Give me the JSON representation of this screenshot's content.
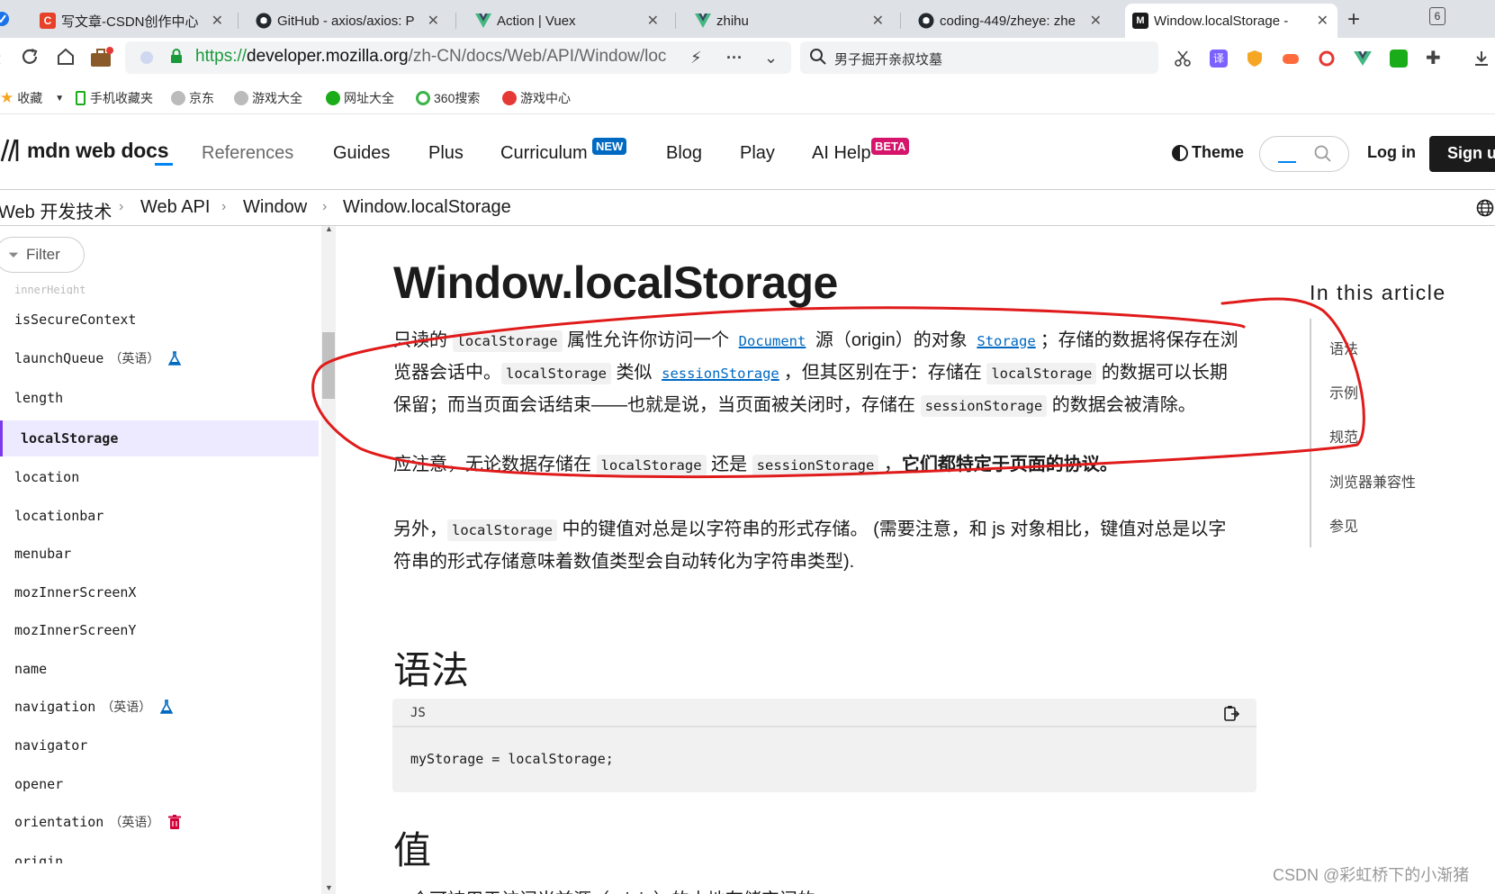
{
  "browser": {
    "tabs": [
      {
        "title": "写文章-CSDN创作中心",
        "icon": "csdn-icon",
        "color": "#e8412a"
      },
      {
        "title": "GitHub - axios/axios: P",
        "icon": "github-icon",
        "color": "#24292f"
      },
      {
        "title": "Action | Vuex",
        "icon": "vue-icon",
        "color": "#42b883"
      },
      {
        "title": "zhihu",
        "icon": "vue-icon",
        "color": "#42b883"
      },
      {
        "title": "coding-449/zheye: zhe",
        "icon": "github-icon",
        "color": "#24292f"
      },
      {
        "title": "Window.localStorage -",
        "icon": "mdn-icon",
        "color": "#1b1b1b"
      }
    ],
    "tab_count": "6",
    "url": {
      "protocol": "https://",
      "host": "developer.mozilla.org",
      "path": "/zh-CN/docs/Web/API/Window/loc"
    },
    "search_query": "男子掘开亲叔坟墓",
    "bookmarks": [
      "收藏",
      "手机收藏夹",
      "京东",
      "游戏大全",
      "网址大全",
      "360搜索",
      "游戏中心"
    ]
  },
  "mdn": {
    "logo": "mdn web docs",
    "menu": [
      "References",
      "Guides",
      "Plus",
      "Curriculum",
      "Blog",
      "Play",
      "AI Help"
    ],
    "badge_new": "NEW",
    "badge_beta": "BETA",
    "theme": "Theme",
    "login": "Log in",
    "signup": "Sign up",
    "accent": "#0085f2"
  },
  "breadcrumb": [
    "Web 开发技术",
    "Web API",
    "Window",
    "Window.localStorage"
  ],
  "sidebar": {
    "filter": "Filter",
    "tag_en": "（英语）",
    "items": [
      "isSecureContext",
      "launchQueue",
      "length",
      "localStorage",
      "location",
      "locationbar",
      "menubar",
      "mozInnerScreenX",
      "mozInnerScreenY",
      "name",
      "navigation",
      "navigator",
      "opener",
      "orientation",
      "origin"
    ]
  },
  "article": {
    "title": "Window.localStorage",
    "p1": {
      "t1": "只读的 ",
      "c1": "localStorage",
      "t2": " 属性允许你访问一个 ",
      "l1": "Document",
      "t3": " 源（origin）的对象 ",
      "l2": "Storage",
      "t4": "；存储的数据将保存在浏览器会话中。",
      "c2": "localStorage",
      "t5": " 类似 ",
      "l3": "sessionStorage",
      "t6": "，但其区别在于：存储在 ",
      "c3": "localStorage",
      "t7": " 的数据可以长期保留；而当页面会话结束——也就是说，当页面被关闭时，存储在 ",
      "c4": "sessionStorage",
      "t8": " 的数据会被清除。"
    },
    "p2": {
      "t1": "应注意，无论数据存储在 ",
      "c1": "localStorage",
      "t2": " 还是 ",
      "c2": "sessionStorage",
      "t3": " ，",
      "b1": "它们都特定于页面的协议。"
    },
    "p3": {
      "t1": "另外，",
      "c1": "localStorage",
      "t2": " 中的键值对总是以字符串的形式存储。 (需要注意，和 js 对象相比，键值对总是以字符串的形式存储意味着数值类型会自动转化为字符串类型)."
    },
    "h_syntax": "语法",
    "code_lang": "JS",
    "code": "myStorage = localStorage;",
    "h_value": "值",
    "cut_text": "一个可被用于访问当前源（origin）的本地存储空间的"
  },
  "toc": {
    "title": "In this article",
    "items": [
      "语法",
      "示例",
      "规范",
      "浏览器兼容性",
      "参见"
    ]
  },
  "watermark": "CSDN @彩虹桥下的小渐猪",
  "annotation_color": "#e01b1b"
}
